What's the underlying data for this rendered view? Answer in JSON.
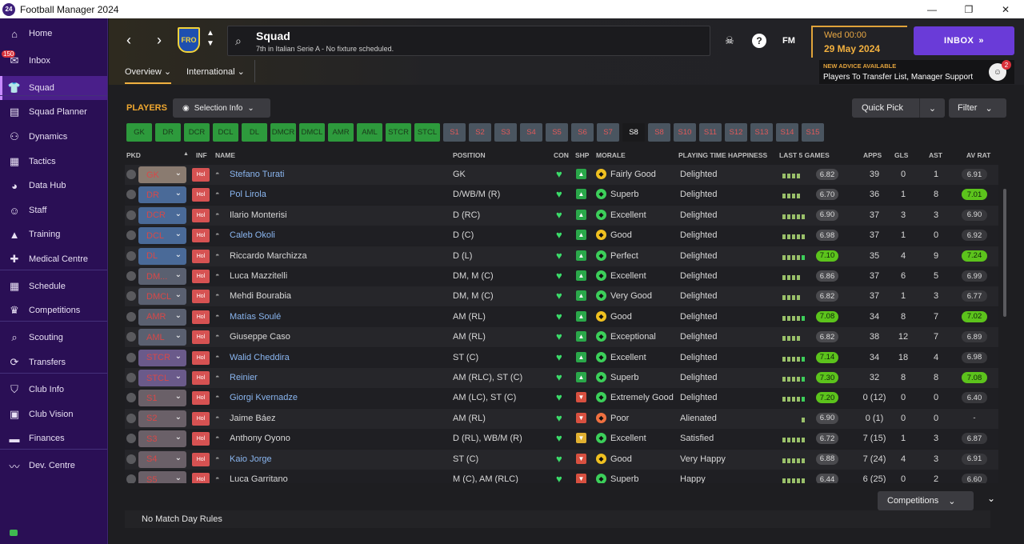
{
  "window": {
    "logo": "24",
    "title": "Football Manager 2024",
    "controls": [
      "—",
      "❐",
      "✕"
    ]
  },
  "sidebar": {
    "items": [
      {
        "label": "Home",
        "icon": "home-icon"
      },
      {
        "label": "Inbox",
        "icon": "inbox-icon",
        "badge": "150"
      },
      {
        "label": "Squad",
        "icon": "squad-icon"
      },
      {
        "label": "Squad Planner",
        "icon": "clipboard-icon"
      },
      {
        "label": "Dynamics",
        "icon": "people-icon"
      },
      {
        "label": "Tactics",
        "icon": "tactics-board-icon"
      },
      {
        "label": "Data Hub",
        "icon": "data-hub-icon"
      },
      {
        "label": "Staff",
        "icon": "staff-icon"
      },
      {
        "label": "Training",
        "icon": "cone-icon"
      },
      {
        "label": "Medical Centre",
        "icon": "medical-icon"
      },
      {
        "label": "Schedule",
        "icon": "calendar-icon"
      },
      {
        "label": "Competitions",
        "icon": "trophy-icon"
      },
      {
        "label": "Scouting",
        "icon": "search-icon"
      },
      {
        "label": "Transfers",
        "icon": "transfer-icon"
      },
      {
        "label": "Club Info",
        "icon": "shield-icon"
      },
      {
        "label": "Club Vision",
        "icon": "briefcase-icon"
      },
      {
        "label": "Finances",
        "icon": "money-icon"
      },
      {
        "label": "Dev. Centre",
        "icon": "dev-centre-icon"
      }
    ]
  },
  "header": {
    "crest_text": "FRO",
    "title": "Squad",
    "subtitle": "7th in Italian Serie A - No fixture scheduled.",
    "fm_label": "FM",
    "date_line1": "Wed 00:00",
    "date_line2": "29 May 2024",
    "inbox_label": "INBOX",
    "advice_title": "NEW ADVICE AVAILABLE",
    "advice_text": "Players To Transfer List, Manager Support",
    "advice_count": "2",
    "tabs": [
      {
        "label": "Overview"
      },
      {
        "label": "International"
      }
    ]
  },
  "toolbar": {
    "players_label": "PLAYERS",
    "selection_info": "Selection Info",
    "quick_pick": "Quick Pick",
    "filter": "Filter"
  },
  "positions": [
    "GK",
    "DR",
    "DCR",
    "DCL",
    "DL",
    "DMCR",
    "DMCL",
    "AMR",
    "AML",
    "STCR",
    "STCL",
    "S1",
    "S2",
    "S3",
    "S4",
    "S5",
    "S6",
    "S7",
    "S8",
    "S8",
    "S10",
    "S11",
    "S12",
    "S13",
    "S14",
    "S15"
  ],
  "positions_green_count": 11,
  "positions_selected_index": 18,
  "columns": {
    "pkd": "PKD",
    "inf": "INF",
    "name": "NAME",
    "position": "POSITION",
    "con": "CON",
    "shp": "SHP",
    "morale": "MORALE",
    "pth": "PLAYING TIME HAPPINESS",
    "last5": "LAST 5 GAMES",
    "apps": "APPS",
    "gls": "GLS",
    "ast": "AST",
    "avrat": "AV RAT"
  },
  "colors": {
    "accent_orange": "#f0a830",
    "inbox_purple": "#6a3bd8",
    "rating_green": "#5cc31c",
    "rating_grey": "#4a4a4e",
    "sidebar": "#2a0f55"
  },
  "players": [
    {
      "pos": "GK",
      "name": "Stefano Turati",
      "link": true,
      "position": "GK",
      "con": "heart",
      "shp": "up",
      "morale": "Fairly Good",
      "mood": "yellow",
      "pth": "Delighted",
      "l5": [
        1,
        1,
        1,
        1,
        0
      ],
      "l5_rating": "6.82",
      "l5_green": false,
      "apps": "39",
      "gls": "0",
      "ast": "1",
      "avrat": "6.91",
      "avrat_green": false,
      "dd": "#8a7b70"
    },
    {
      "pos": "DR",
      "name": "Pol Lirola",
      "link": true,
      "position": "D/WB/M (R)",
      "con": "heart",
      "shp": "up",
      "morale": "Superb",
      "mood": "green",
      "pth": "Delighted",
      "l5": [
        1,
        1,
        1,
        1,
        0
      ],
      "l5_rating": "6.70",
      "l5_green": false,
      "apps": "36",
      "gls": "1",
      "ast": "8",
      "avrat": "7.01",
      "avrat_green": true,
      "dd": "#4a6a98"
    },
    {
      "pos": "DCR",
      "name": "Ilario Monterisi",
      "link": false,
      "position": "D (RC)",
      "con": "heart",
      "shp": "up",
      "morale": "Excellent",
      "mood": "green",
      "pth": "Delighted",
      "l5": [
        1,
        1,
        1,
        1,
        1
      ],
      "l5_rating": "6.90",
      "l5_green": false,
      "apps": "37",
      "gls": "3",
      "ast": "3",
      "avrat": "6.90",
      "avrat_green": false,
      "dd": "#4a6a98"
    },
    {
      "pos": "DCL",
      "name": "Caleb Okoli",
      "link": true,
      "position": "D (C)",
      "con": "heart",
      "shp": "up",
      "morale": "Good",
      "mood": "yellow",
      "pth": "Delighted",
      "l5": [
        1,
        1,
        1,
        1,
        1
      ],
      "l5_rating": "6.98",
      "l5_green": false,
      "apps": "37",
      "gls": "1",
      "ast": "0",
      "avrat": "6.92",
      "avrat_green": false,
      "dd": "#4a6a98"
    },
    {
      "pos": "DL",
      "name": "Riccardo Marchizza",
      "link": false,
      "position": "D (L)",
      "con": "heart",
      "shp": "up",
      "morale": "Perfect",
      "mood": "green",
      "pth": "Delighted",
      "l5": [
        1,
        1,
        1,
        1,
        1
      ],
      "l5_rating": "7.10",
      "l5_green": true,
      "apps": "35",
      "gls": "4",
      "ast": "9",
      "avrat": "7.24",
      "avrat_green": true,
      "dd": "#4a6a98"
    },
    {
      "pos": "DM...",
      "name": "Luca Mazzitelli",
      "link": false,
      "position": "DM, M (C)",
      "con": "heart",
      "shp": "up",
      "morale": "Excellent",
      "mood": "green",
      "pth": "Delighted",
      "l5": [
        1,
        1,
        1,
        1,
        0
      ],
      "l5_rating": "6.86",
      "l5_green": false,
      "apps": "37",
      "gls": "6",
      "ast": "5",
      "avrat": "6.99",
      "avrat_green": false,
      "dd": "#5a6070"
    },
    {
      "pos": "DMCL",
      "name": "Mehdi Bourabia",
      "link": false,
      "position": "DM, M (C)",
      "con": "heart",
      "shp": "up",
      "morale": "Very Good",
      "mood": "green",
      "pth": "Delighted",
      "l5": [
        1,
        1,
        1,
        1,
        0
      ],
      "l5_rating": "6.82",
      "l5_green": false,
      "apps": "37",
      "gls": "1",
      "ast": "3",
      "avrat": "6.77",
      "avrat_green": false,
      "dd": "#5a6070"
    },
    {
      "pos": "AMR",
      "name": "Matías Soulé",
      "link": true,
      "position": "AM (RL)",
      "con": "heart",
      "shp": "up",
      "morale": "Good",
      "mood": "yellow",
      "pth": "Delighted",
      "l5": [
        1,
        1,
        1,
        1,
        1
      ],
      "l5_rating": "7.08",
      "l5_green": true,
      "apps": "34",
      "gls": "8",
      "ast": "7",
      "avrat": "7.02",
      "avrat_green": true,
      "dd": "#5a6070"
    },
    {
      "pos": "AML",
      "name": "Giuseppe Caso",
      "link": false,
      "position": "AM (RL)",
      "con": "heart",
      "shp": "up",
      "morale": "Exceptional",
      "mood": "green",
      "pth": "Delighted",
      "l5": [
        1,
        1,
        1,
        1,
        0
      ],
      "l5_rating": "6.82",
      "l5_green": false,
      "apps": "38",
      "gls": "12",
      "ast": "7",
      "avrat": "6.89",
      "avrat_green": false,
      "dd": "#5a6070"
    },
    {
      "pos": "STCR",
      "name": "Walid Cheddira",
      "link": true,
      "position": "ST (C)",
      "con": "heart",
      "shp": "up",
      "morale": "Excellent",
      "mood": "green",
      "pth": "Delighted",
      "l5": [
        1,
        1,
        1,
        1,
        1
      ],
      "l5_rating": "7.14",
      "l5_green": true,
      "apps": "34",
      "gls": "18",
      "ast": "4",
      "avrat": "6.98",
      "avrat_green": false,
      "dd": "#6a5a8a"
    },
    {
      "pos": "STCL",
      "name": "Reinier",
      "link": true,
      "position": "AM (RLC), ST (C)",
      "con": "heart",
      "shp": "up",
      "morale": "Superb",
      "mood": "green",
      "pth": "Delighted",
      "l5": [
        1,
        1,
        1,
        1,
        1
      ],
      "l5_rating": "7.30",
      "l5_green": true,
      "apps": "32",
      "gls": "8",
      "ast": "8",
      "avrat": "7.08",
      "avrat_green": true,
      "dd": "#6a5a8a"
    },
    {
      "pos": "S1",
      "name": "Giorgi Kvernadze",
      "link": true,
      "position": "AM (LC), ST (C)",
      "con": "heart",
      "shp": "down",
      "morale": "Extremely Good",
      "mood": "green",
      "pth": "Delighted",
      "l5": [
        1,
        1,
        1,
        1,
        1
      ],
      "l5_rating": "7.20",
      "l5_green": true,
      "apps": "0 (12)",
      "gls": "0",
      "ast": "0",
      "avrat": "6.40",
      "avrat_green": false,
      "dd": "#6a6068"
    },
    {
      "pos": "S2",
      "name": "Jaime Báez",
      "link": false,
      "position": "AM (RL)",
      "con": "heart",
      "shp": "down",
      "morale": "Poor",
      "mood": "orange",
      "pth": "Alienated",
      "l5": [
        0,
        0,
        0,
        0,
        1
      ],
      "l5_rating": "6.90",
      "l5_green": false,
      "apps": "0 (1)",
      "gls": "0",
      "ast": "0",
      "avrat": "-",
      "avrat_green": false,
      "dd": "#6a6068"
    },
    {
      "pos": "S3",
      "name": "Anthony Oyono",
      "link": false,
      "position": "D (RL), WB/M (R)",
      "con": "heart",
      "shp": "down2",
      "morale": "Excellent",
      "mood": "green",
      "pth": "Satisfied",
      "l5": [
        1,
        1,
        1,
        1,
        1
      ],
      "l5_rating": "6.72",
      "l5_green": false,
      "apps": "7 (15)",
      "gls": "1",
      "ast": "3",
      "avrat": "6.87",
      "avrat_green": false,
      "dd": "#6a6068"
    },
    {
      "pos": "S4",
      "name": "Kaio Jorge",
      "link": true,
      "position": "ST (C)",
      "con": "heart",
      "shp": "down",
      "morale": "Good",
      "mood": "yellow",
      "pth": "Very Happy",
      "l5": [
        1,
        1,
        1,
        1,
        1
      ],
      "l5_rating": "6.88",
      "l5_green": false,
      "apps": "7 (24)",
      "gls": "4",
      "ast": "3",
      "avrat": "6.91",
      "avrat_green": false,
      "dd": "#6a6068"
    },
    {
      "pos": "S5",
      "name": "Luca Garritano",
      "link": false,
      "position": "M (C), AM (RLC)",
      "con": "heart",
      "shp": "down",
      "morale": "Superb",
      "mood": "green",
      "pth": "Happy",
      "l5": [
        1,
        1,
        1,
        1,
        1
      ],
      "l5_rating": "6.44",
      "l5_green": false,
      "apps": "6 (25)",
      "gls": "0",
      "ast": "2",
      "avrat": "6.60",
      "avrat_green": false,
      "dd": "#6a6068"
    }
  ],
  "bottom": {
    "competitions": "Competitions",
    "no_match_day": "No Match Day Rules"
  }
}
